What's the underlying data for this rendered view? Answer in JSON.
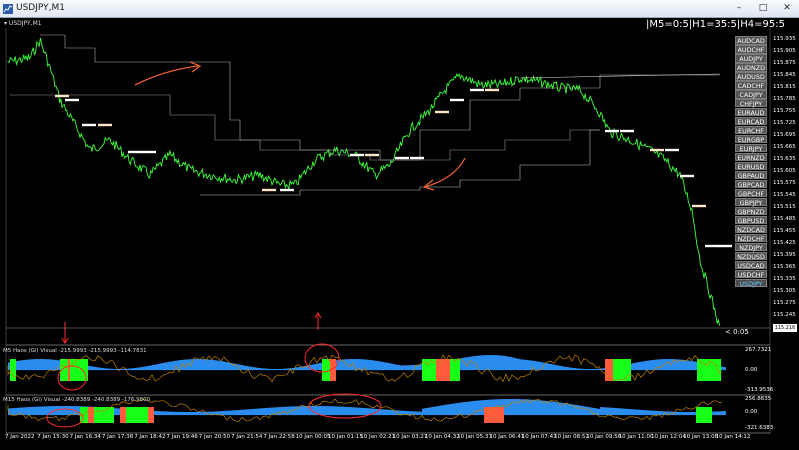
{
  "window": {
    "title": "USDJPY,M1",
    "subtitle": "USDJPY,M1"
  },
  "corner_text": "|M5=0:5|H1=35:5|H4=95:5",
  "symbols": [
    "AUDCAD",
    "AUDCHF",
    "AUDJPY",
    "AUDNZD",
    "AUDUSD",
    "CADCHF",
    "CADJPY",
    "CHFJPY",
    "EURAUD",
    "EURCAD",
    "EURCHF",
    "EURGBP",
    "EURJPY",
    "EURNZD",
    "EURUSD",
    "GBPAUD",
    "GBPCAD",
    "GBPCHF",
    "GBPJPY",
    "GBPNZD",
    "GBPUSD",
    "NZDCAD",
    "NZDCHF",
    "NZDJPY",
    "NZDUSD",
    "USDCAD",
    "USDCHF",
    "USDJPY"
  ],
  "selected_symbol": "USDJPY",
  "price_axis": {
    "ticks": [
      "115.935",
      "115.905",
      "115.875",
      "115.845",
      "115.815",
      "115.785",
      "115.755",
      "115.725",
      "115.695",
      "115.665",
      "115.635",
      "115.605",
      "115.575",
      "115.545",
      "115.515",
      "115.485",
      "115.455",
      "115.425",
      "115.395",
      "115.365",
      "115.335",
      "115.305",
      "115.275",
      "115.245",
      "115.215"
    ],
    "current_price": "115.216",
    "ymin": 115.205,
    "ymax": 115.945
  },
  "last_quote": "< 0:05",
  "time_axis": [
    "7 Jan 2022",
    "7 Jan 15:30",
    "7 Jan 16:34",
    "7 Jan 17:38",
    "7 Jan 18:42",
    "7 Jan 19:46",
    "7 Jan 20:50",
    "7 Jan 21:54",
    "7 Jan 22:58",
    "10 Jan 00:05",
    "10 Jan 01:15",
    "10 Jan 02:21",
    "10 Jan 03:27",
    "10 Jan 04:32",
    "10 Jan 05:37",
    "10 Jan 06:41",
    "10 Jan 07:47",
    "10 Jan 08:52",
    "10 Jan 09:56",
    "10 Jan 11:00",
    "10 Jan 12:04",
    "10 Jan 13:08",
    "10 Jan 14:12"
  ],
  "indicator1": {
    "title": "M5 Haos (Gi) Visual -215.9993 -215.9993 -114.7831",
    "levels": [
      "267.7321",
      "0.00",
      "-313.9536"
    ]
  },
  "indicator2": {
    "title": "M15 Haos (Gi) Visual -240.8389 -240.8389 -176.9800",
    "levels": [
      "256.8635",
      "0.00",
      "-321.6383"
    ]
  },
  "colors": {
    "price": "#3cff3c",
    "level_line": "#c8c8c8",
    "step": "#ffffff",
    "step_alt": "#ffe4c8",
    "annotation": "#e86030",
    "mark": "#ff2b2b",
    "hist_blue": "#2b8cf0",
    "hist_green": "#18ff18",
    "hist_red": "#ff5a3c",
    "ind_line": "#c08000"
  }
}
